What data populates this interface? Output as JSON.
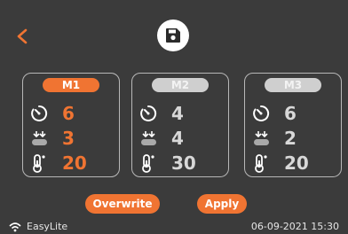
{
  "colors": {
    "accent": "#f07432",
    "background": "#3b3b3b",
    "inactive_badge": "#cfcfcf"
  },
  "nav": {
    "back_label": "<"
  },
  "presets": [
    {
      "name": "M1",
      "timer": "6",
      "speed": "3",
      "temp": "20",
      "active": true
    },
    {
      "name": "M2",
      "timer": "4",
      "speed": "4",
      "temp": "30",
      "active": false
    },
    {
      "name": "M3",
      "timer": "6",
      "speed": "2",
      "temp": "20",
      "active": false
    }
  ],
  "actions": {
    "overwrite_label": "Overwrite",
    "apply_label": "Apply"
  },
  "status": {
    "brand": "EasyLite",
    "datetime": "06-09-2021  15:30"
  },
  "icons": {
    "back": "chevron-left-icon",
    "save": "floppy-disk-icon",
    "timer": "timer-icon",
    "speed": "downward-arrows-icon",
    "temp": "thermometer-icon",
    "wifi": "wifi-icon"
  }
}
